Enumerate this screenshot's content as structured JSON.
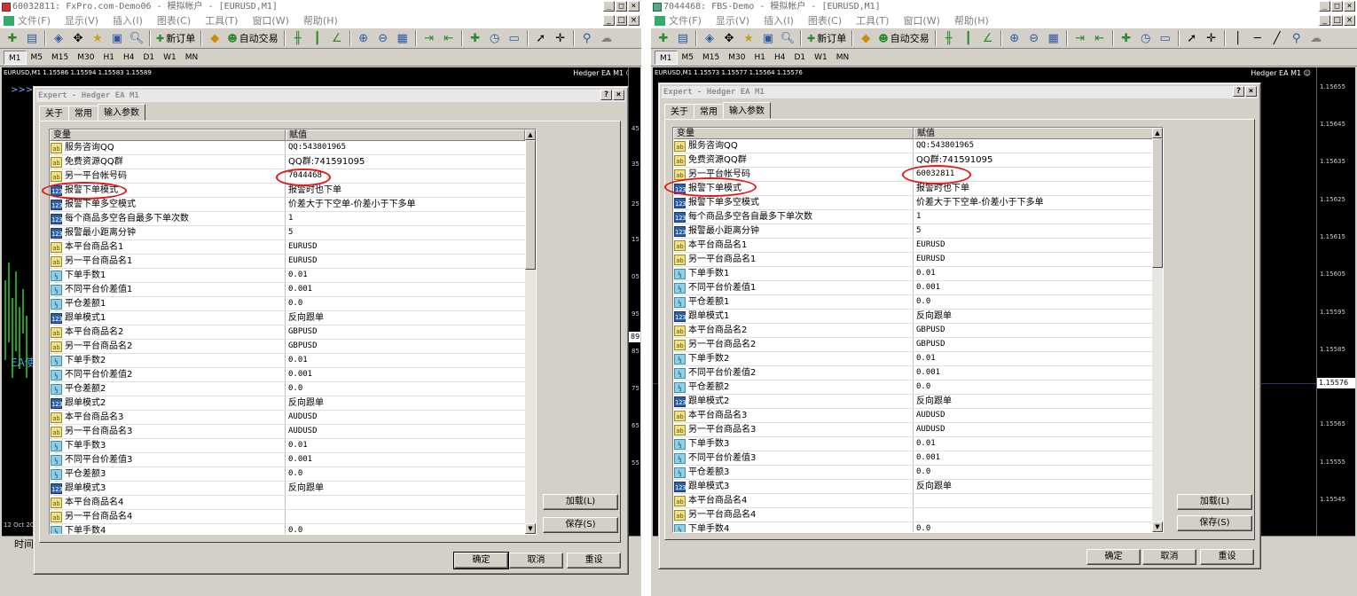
{
  "window1": {
    "title": "60032811: FxPro.com-Demo06 - 模拟帐户 - [EURUSD,M1]",
    "menu": [
      "文件(F)",
      "显示(V)",
      "插入(I)",
      "图表(C)",
      "工具(T)",
      "窗口(W)",
      "帮助(H)"
    ],
    "toolbar": {
      "new_order": "新订单",
      "auto_trade": "自动交易"
    },
    "timeframes": [
      "M1",
      "M5",
      "M15",
      "M30",
      "H1",
      "H4",
      "D1",
      "W1",
      "MN"
    ],
    "chart_header": "EURUSD,M1  1.15586 1.15594 1.15583 1.15589",
    "chart_ea": "Hedger EA M1 ☺",
    "chart_marks": [
      ">>>",
      "EA使"
    ],
    "price_labels": [
      "45",
      "35",
      "25",
      "15",
      "05",
      "95",
      "85",
      "75",
      "65",
      "55"
    ],
    "current_price": "89",
    "date_label": "12 Oct 20",
    "terminal_tab": "时间",
    "dialog": {
      "title": "Expert - Hedger EA M1",
      "tabs": [
        "关于",
        "常用",
        "输入参数"
      ],
      "col_variable": "变量",
      "col_value": "赋值",
      "rows": [
        {
          "type": "ab",
          "name": "服务咨询QQ",
          "value": "QQ:543801965"
        },
        {
          "type": "ab",
          "name": "免费资源QQ群",
          "value": "QQ群:741591095"
        },
        {
          "type": "ab",
          "name": "另一平台帐号码",
          "value": "7044468"
        },
        {
          "type": "123",
          "name": "报警下单模式",
          "value": "报警时也下单"
        },
        {
          "type": "123",
          "name": "报警下单多空模式",
          "value": "价差大于下空单-价差小于下多单"
        },
        {
          "type": "123",
          "name": "每个商品多空各自最多下单次数",
          "value": "1"
        },
        {
          "type": "123",
          "name": "报警最小距离分钟",
          "value": "5"
        },
        {
          "type": "ab",
          "name": "本平台商品名1",
          "value": "EURUSD"
        },
        {
          "type": "ab",
          "name": "另一平台商品名1",
          "value": "EURUSD"
        },
        {
          "type": "v2",
          "name": "下单手数1",
          "value": "0.01"
        },
        {
          "type": "v2",
          "name": "不同平台价差值1",
          "value": "0.001"
        },
        {
          "type": "v2",
          "name": "平仓差额1",
          "value": "0.0"
        },
        {
          "type": "123",
          "name": "跟单模式1",
          "value": "反向跟单"
        },
        {
          "type": "ab",
          "name": "本平台商品名2",
          "value": "GBPUSD"
        },
        {
          "type": "ab",
          "name": "另一平台商品名2",
          "value": "GBPUSD"
        },
        {
          "type": "v2",
          "name": "下单手数2",
          "value": "0.01"
        },
        {
          "type": "v2",
          "name": "不同平台价差值2",
          "value": "0.001"
        },
        {
          "type": "v2",
          "name": "平仓差额2",
          "value": "0.0"
        },
        {
          "type": "123",
          "name": "跟单模式2",
          "value": "反向跟单"
        },
        {
          "type": "ab",
          "name": "本平台商品名3",
          "value": "AUDUSD"
        },
        {
          "type": "ab",
          "name": "另一平台商品名3",
          "value": "AUDUSD"
        },
        {
          "type": "v2",
          "name": "下单手数3",
          "value": "0.01"
        },
        {
          "type": "v2",
          "name": "不同平台价差值3",
          "value": "0.001"
        },
        {
          "type": "v2",
          "name": "平仓差额3",
          "value": "0.0"
        },
        {
          "type": "123",
          "name": "跟单模式3",
          "value": "反向跟单"
        },
        {
          "type": "ab",
          "name": "本平台商品名4",
          "value": ""
        },
        {
          "type": "ab",
          "name": "另一平台商品名4",
          "value": ""
        },
        {
          "type": "v2",
          "name": "下单手数4",
          "value": "0.0"
        }
      ],
      "load_button": "加载(L)",
      "save_button": "保存(S)",
      "ok_button": "确定",
      "cancel_button": "取消",
      "reset_button": "重设"
    }
  },
  "window2": {
    "title": "7044468: FBS-Demo - 模拟帐户 - [EURUSD,M1]",
    "menu": [
      "文件(F)",
      "显示(V)",
      "插入(I)",
      "图表(C)",
      "工具(T)",
      "窗口(W)",
      "帮助(H)"
    ],
    "toolbar": {
      "new_order": "新订单",
      "auto_trade": "自动交易"
    },
    "timeframes": [
      "M1",
      "M5",
      "M15",
      "M30",
      "H1",
      "H4",
      "D1",
      "W1",
      "MN"
    ],
    "chart_header": "EURUSD,M1  1.15573 1.15577 1.15564 1.15576",
    "chart_ea": "Hedger EA M1 ☺",
    "price_labels": [
      "1.15655",
      "1.15645",
      "1.15635",
      "1.15625",
      "1.15615",
      "1.15605",
      "1.15595",
      "1.15585",
      "1.15575",
      "1.15565",
      "1.15555",
      "1.15545"
    ],
    "current_price": "1.15576",
    "dialog": {
      "title": "Expert - Hedger EA M1",
      "tabs": [
        "关于",
        "常用",
        "输入参数"
      ],
      "col_variable": "变量",
      "col_value": "赋值",
      "rows": [
        {
          "type": "ab",
          "name": "服务咨询QQ",
          "value": "QQ:543801965"
        },
        {
          "type": "ab",
          "name": "免费资源QQ群",
          "value": "QQ群:741591095"
        },
        {
          "type": "ab",
          "name": "另一平台帐号码",
          "value": "60032811"
        },
        {
          "type": "123",
          "name": "报警下单模式",
          "value": "报警时也下单"
        },
        {
          "type": "123",
          "name": "报警下单多空模式",
          "value": "价差大于下空单-价差小于下多单"
        },
        {
          "type": "123",
          "name": "每个商品多空各自最多下单次数",
          "value": "1"
        },
        {
          "type": "123",
          "name": "报警最小距离分钟",
          "value": "5"
        },
        {
          "type": "ab",
          "name": "本平台商品名1",
          "value": "EURUSD"
        },
        {
          "type": "ab",
          "name": "另一平台商品名1",
          "value": "EURUSD"
        },
        {
          "type": "v2",
          "name": "下单手数1",
          "value": "0.01"
        },
        {
          "type": "v2",
          "name": "不同平台价差值1",
          "value": "0.001"
        },
        {
          "type": "v2",
          "name": "平仓差额1",
          "value": "0.0"
        },
        {
          "type": "123",
          "name": "跟单模式1",
          "value": "反向跟单"
        },
        {
          "type": "ab",
          "name": "本平台商品名2",
          "value": "GBPUSD"
        },
        {
          "type": "ab",
          "name": "另一平台商品名2",
          "value": "GBPUSD"
        },
        {
          "type": "v2",
          "name": "下单手数2",
          "value": "0.01"
        },
        {
          "type": "v2",
          "name": "不同平台价差值2",
          "value": "0.001"
        },
        {
          "type": "v2",
          "name": "平仓差额2",
          "value": "0.0"
        },
        {
          "type": "123",
          "name": "跟单模式2",
          "value": "反向跟单"
        },
        {
          "type": "ab",
          "name": "本平台商品名3",
          "value": "AUDUSD"
        },
        {
          "type": "ab",
          "name": "另一平台商品名3",
          "value": "AUDUSD"
        },
        {
          "type": "v2",
          "name": "下单手数3",
          "value": "0.01"
        },
        {
          "type": "v2",
          "name": "不同平台价差值3",
          "value": "0.001"
        },
        {
          "type": "v2",
          "name": "平仓差额3",
          "value": "0.0"
        },
        {
          "type": "123",
          "name": "跟单模式3",
          "value": "反向跟单"
        },
        {
          "type": "ab",
          "name": "本平台商品名4",
          "value": ""
        },
        {
          "type": "ab",
          "name": "另一平台商品名4",
          "value": ""
        },
        {
          "type": "v2",
          "name": "下单手数4",
          "value": "0.0"
        }
      ],
      "load_button": "加载(L)",
      "save_button": "保存(S)",
      "ok_button": "确定",
      "cancel_button": "取消",
      "reset_button": "重设"
    }
  },
  "colors": {
    "highlight_ring": "#e01818",
    "chart_bg": "#000000",
    "dialog_bg": "#d4d0c8"
  }
}
